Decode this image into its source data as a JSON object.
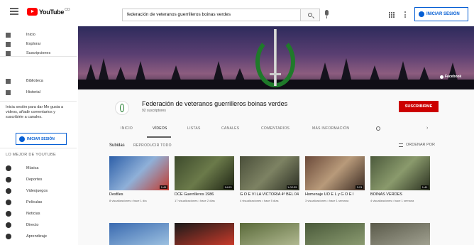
{
  "topbar": {
    "logo_text": "YouTube",
    "logo_country": "CO",
    "search_value": "federación de veteranos guerrilleros boinas verdes",
    "signin_label": "INICIAR SESIÓN"
  },
  "sidebar": {
    "main": [
      {
        "label": "Inicio",
        "icon": "home-icon"
      },
      {
        "label": "Explorar",
        "icon": "explore-icon"
      },
      {
        "label": "Suscripciones",
        "icon": "subscriptions-icon"
      }
    ],
    "library": [
      {
        "label": "Biblioteca",
        "icon": "library-icon"
      },
      {
        "label": "Historial",
        "icon": "history-icon"
      }
    ],
    "note": "Inicia sesión para dar Me gusta a videos, añadir comentarios y suscribirte a canales.",
    "signin_label": "INICIAR SESIÓN",
    "best_heading": "LO MEJOR DE YOUTUBE",
    "best": [
      {
        "label": "Música",
        "icon": "music-icon"
      },
      {
        "label": "Deportes",
        "icon": "sports-icon"
      },
      {
        "label": "Videojuegos",
        "icon": "gaming-icon"
      },
      {
        "label": "Películas",
        "icon": "movies-icon"
      },
      {
        "label": "Noticias",
        "icon": "news-icon"
      },
      {
        "label": "Directo",
        "icon": "live-icon"
      },
      {
        "label": "Aprendizaje",
        "icon": "learning-icon"
      }
    ]
  },
  "banner": {
    "badge": "Facebook"
  },
  "channel": {
    "name": "Federación de veteranos guerrilleros boinas verdes",
    "subscribers": "92 suscriptores",
    "subscribe_label": "SUSCRIBIRME",
    "tabs": [
      "INICIO",
      "VÍDEOS",
      "LISTAS",
      "CANALES",
      "COMENTARIOS",
      "MÁS INFORMACIÓN"
    ],
    "active_tab": "VÍDEOS"
  },
  "shelf": {
    "title": "Subidas",
    "play_all": "REPRODUCIR TODO",
    "sort_label": "ORDENAR POR"
  },
  "videos": [
    {
      "title": "Desfiles",
      "meta": "8 visualizaciones • hace 1 día",
      "duration": "1:41",
      "colors": [
        "#2d5fa8",
        "#8fb0d8",
        "#c23b2e"
      ]
    },
    {
      "title": "DCE Guerrilleros 1986",
      "meta": "17 visualizaciones • hace 2 días",
      "duration": "14:03",
      "colors": [
        "#3d4a2c",
        "#6b7a4a",
        "#1e2414"
      ]
    },
    {
      "title": "G O E VI LA VICTORIA 4º BEL 04",
      "meta": "4 visualizaciones • hace 5 días",
      "duration": "1:02:35",
      "colors": [
        "#4a4f3a",
        "#7d8263",
        "#2b2e22"
      ]
    },
    {
      "title": "Homenaje UO E L y G O E I",
      "meta": "3 visualizaciones • hace 1 semana",
      "duration": "3:21",
      "colors": [
        "#6b4a3a",
        "#b89a7a",
        "#3a2a22"
      ]
    },
    {
      "title": "BOINAS VERDES",
      "meta": "4 visualizaciones • hace 1 semana",
      "duration": "1:41",
      "colors": [
        "#4c5a3c",
        "#8a9a6c",
        "#2a3020"
      ]
    }
  ],
  "videos_row2": [
    {
      "colors": [
        "#3a6ab0",
        "#9cc0e0"
      ]
    },
    {
      "colors": [
        "#1a1a1a",
        "#c83a2a"
      ]
    },
    {
      "colors": [
        "#5a6a3a",
        "#b0b890"
      ]
    },
    {
      "colors": [
        "#4a5a3a",
        "#8a9a70"
      ]
    },
    {
      "colors": [
        "#5a5a4a",
        "#a0a090"
      ]
    }
  ]
}
